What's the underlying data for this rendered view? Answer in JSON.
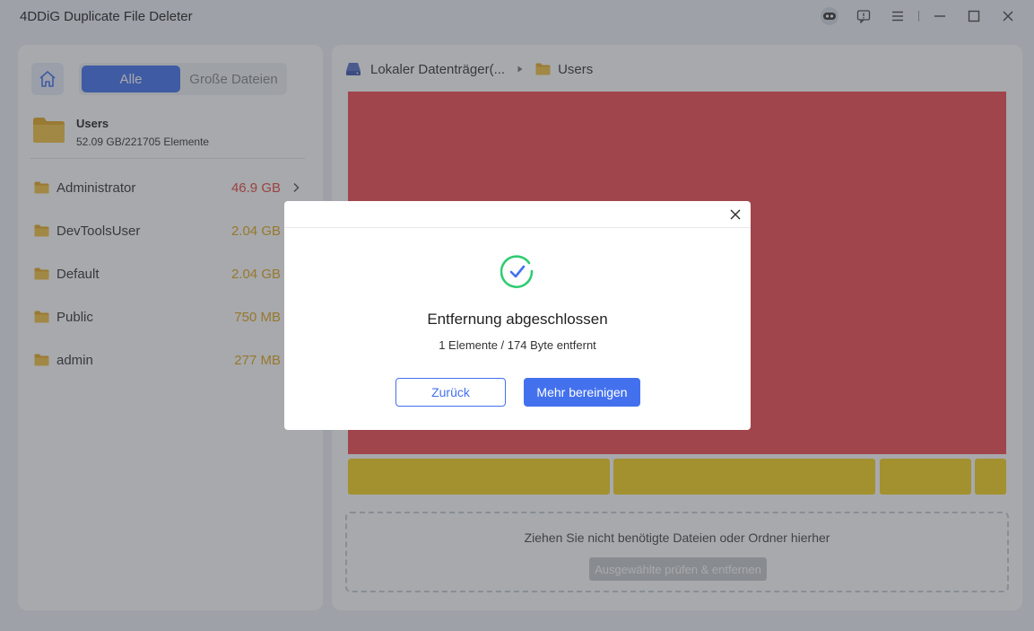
{
  "window": {
    "title": "4DDiG Duplicate File Deleter"
  },
  "title_icons": [
    "assistant-icon",
    "feedback-icon",
    "menu-icon",
    "minimize-icon",
    "maximize-icon",
    "close-icon"
  ],
  "sidebar": {
    "tabs": {
      "all_label": "Alle",
      "large_label": "Große Dateien"
    },
    "current_folder": {
      "name": "Users",
      "summary": "52.09 GB/221705 Elemente"
    },
    "folders": [
      {
        "name": "Administrator",
        "size": "46.9 GB",
        "color": "#e8453c"
      },
      {
        "name": "DevToolsUser",
        "size": "2.04 GB",
        "color": "#e2a61a"
      },
      {
        "name": "Default",
        "size": "2.04 GB",
        "color": "#e2a61a"
      },
      {
        "name": "Public",
        "size": "750 MB",
        "color": "#e2a61a"
      },
      {
        "name": "admin",
        "size": "277 MB",
        "color": "#e2a61a"
      }
    ]
  },
  "main": {
    "breadcrumb": {
      "drive": "Lokaler Datenträger(...",
      "folder": "Users"
    },
    "treemap_colors": {
      "large": "#f44a52",
      "small": "#f8d21c"
    },
    "drop_zone": {
      "text": "Ziehen Sie nicht benötigte Dateien oder Ordner hierher",
      "button_label": "Ausgewählte prüfen & entfernen"
    }
  },
  "dialog": {
    "title": "Entfernung abgeschlossen",
    "subtitle": "1 Elemente / 174 Byte entfernt",
    "back_label": "Zurück",
    "more_label": "Mehr bereinigen"
  },
  "colors": {
    "accent": "#4371ee",
    "success": "#2ecc71"
  }
}
